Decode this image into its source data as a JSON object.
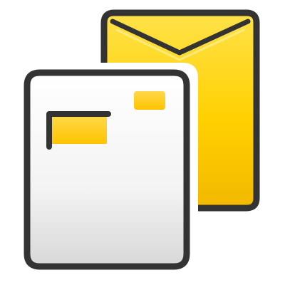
{
  "icon": {
    "name": "mail-document-icon",
    "parts": {
      "envelope": "envelope-icon",
      "document": "letter-document-icon"
    },
    "colors": {
      "outline": "#333333",
      "envelope_yellow_light": "#ffe24a",
      "envelope_yellow": "#ffd000",
      "envelope_yellow_dark": "#f2b800",
      "paper_white": "#ffffff",
      "paper_gray": "#d8d8d8",
      "label_yellow": "#ffcc00",
      "stamp_yellow": "#ffd21a"
    }
  }
}
